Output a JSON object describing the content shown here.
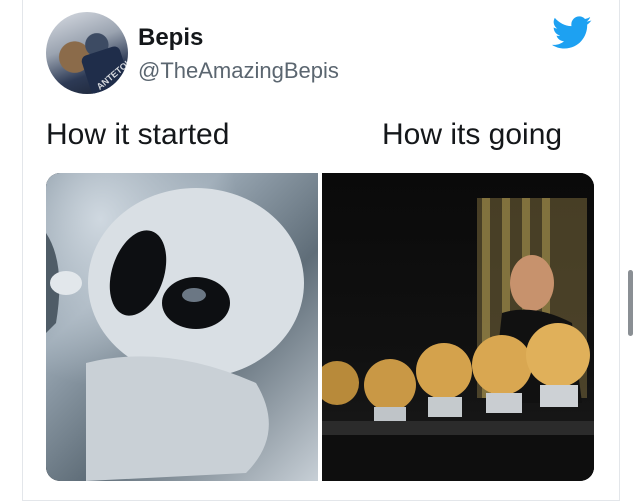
{
  "tweet": {
    "display_name": "Bepis",
    "handle": "@TheAmazingBepis",
    "avatar_icon": "profile-photo-basketball-player",
    "jersey_text": "ANTETOKOUNMPO",
    "brand_icon": "twitter-bird-icon",
    "brand_color": "#1da1f2"
  },
  "meme": {
    "left_caption": "How it started",
    "right_caption": "How its going",
    "left_image": "alien-baby-image",
    "right_image": "messi-ballon-dor-trophies-image"
  }
}
